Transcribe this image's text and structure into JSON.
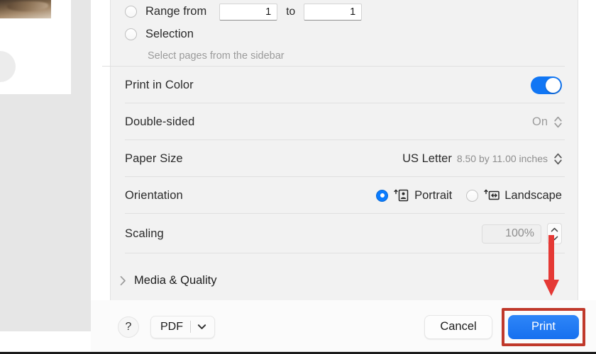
{
  "dialog": {
    "pages_section": {
      "range": {
        "label": "Range from",
        "to_label": "to",
        "from_value": "1",
        "to_value": "1",
        "selected": false
      },
      "selection": {
        "label": "Selection",
        "selected": false
      },
      "hint": "Select pages from the sidebar"
    },
    "rows": {
      "print_in_color": {
        "label": "Print in Color",
        "toggle_on": true,
        "toggle_color": "#1176f4"
      },
      "double_sided": {
        "label": "Double-sided",
        "value": "On",
        "stepper_icon": "chevron-up-down-icon"
      },
      "paper_size": {
        "label": "Paper Size",
        "value": "US Letter",
        "value_detail": "8.50 by 11.00 inches",
        "stepper_icon": "chevron-up-down-icon"
      },
      "orientation": {
        "label": "Orientation",
        "portrait": {
          "label": "Portrait",
          "selected": true,
          "icon": "portrait-page-icon"
        },
        "landscape": {
          "label": "Landscape",
          "selected": false,
          "icon": "landscape-page-icon"
        }
      },
      "scaling": {
        "label": "Scaling",
        "value": "100%",
        "stepper_icon": "stepper-up-down-icon"
      }
    },
    "media_quality": {
      "label": "Media & Quality",
      "chevron_icon": "chevron-right-icon",
      "expanded": false
    },
    "bottom_bar": {
      "help_label": "?",
      "pdf_label": "PDF",
      "pdf_chevron_icon": "chevron-down-icon",
      "cancel_label": "Cancel",
      "print_label": "Print"
    },
    "annotations": {
      "arrow_color": "#e53935",
      "highlight_color": "#c0392b",
      "highlight_target": "print-button"
    }
  }
}
